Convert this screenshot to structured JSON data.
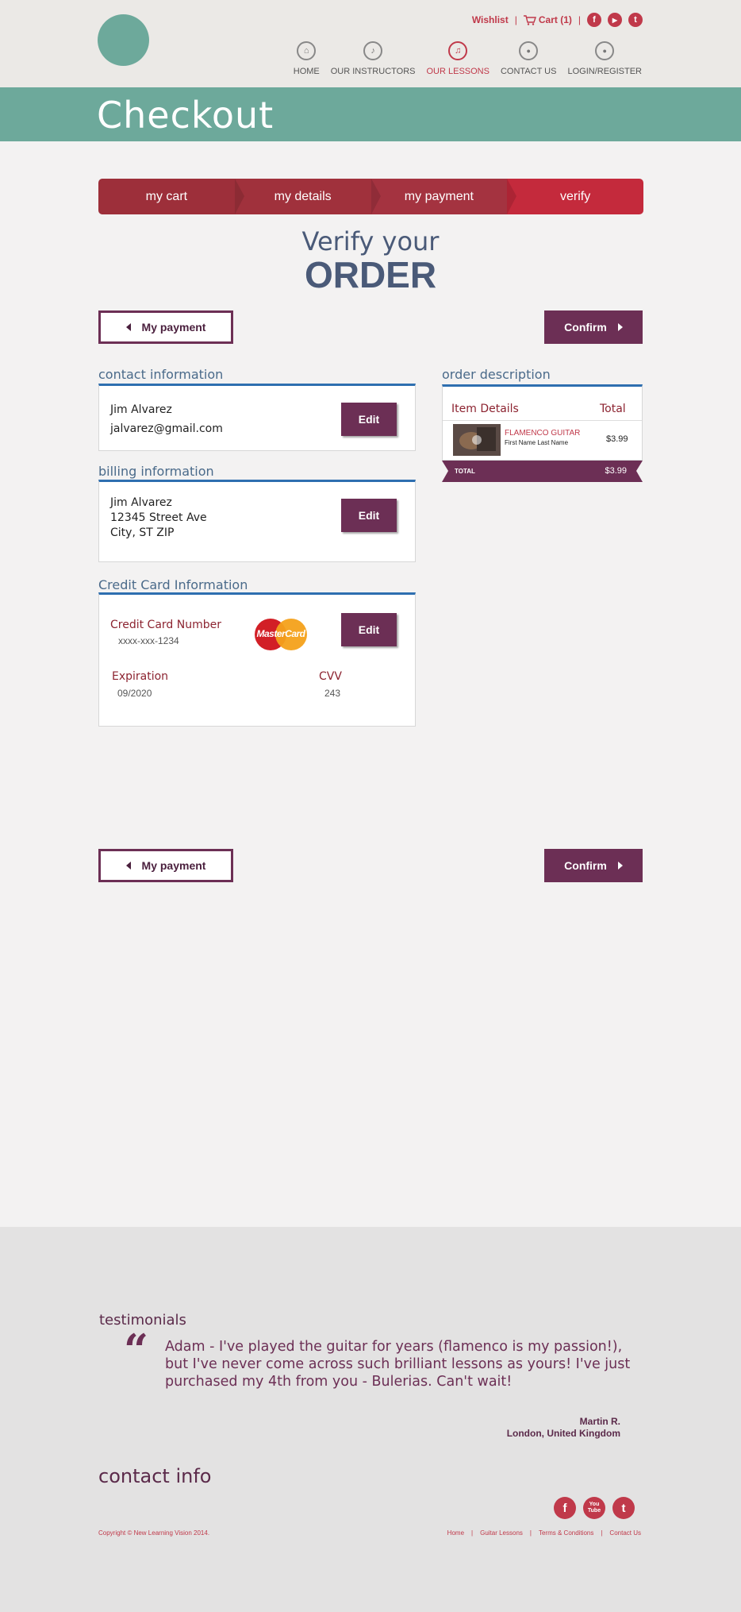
{
  "header": {
    "wishlist": "Wishlist",
    "cart": "Cart (1)",
    "separator": "|",
    "social": [
      "f",
      "▶",
      "t"
    ],
    "nav": [
      {
        "label": "HOME",
        "icon": "home-icon",
        "glyph": "⌂"
      },
      {
        "label": "OUR INSTRUCTORS",
        "icon": "music-note-icon",
        "glyph": "♪"
      },
      {
        "label": "OUR LESSONS",
        "icon": "guitar-icon",
        "glyph": "♫"
      },
      {
        "label": "CONTACT US",
        "icon": "chat-bubble-icon",
        "glyph": "●"
      },
      {
        "label": "LOGIN/REGISTER",
        "icon": "user-icon",
        "glyph": "●"
      }
    ]
  },
  "banner": {
    "title": "Checkout"
  },
  "steps": [
    "my cart",
    "my details",
    "my payment",
    "verify"
  ],
  "verify": {
    "line1": "Verify your",
    "line2": "ORDER"
  },
  "buttons": {
    "back": "My payment",
    "confirm": "Confirm",
    "edit": "Edit"
  },
  "contact": {
    "title": "contact information",
    "name": "Jim Alvarez",
    "email": "jalvarez@gmail.com"
  },
  "billing": {
    "title": "billing information",
    "name": "Jim Alvarez",
    "street": "12345 Street Ave",
    "city": "City, ST ZIP"
  },
  "card": {
    "title": "Credit Card Information",
    "number_label": "Credit Card Number",
    "number": "xxxx-xxx-1234",
    "brand": "MasterCard",
    "expiration_label": "Expiration",
    "expiration": "09/2020",
    "cvv_label": "CVV",
    "cvv": "243"
  },
  "order": {
    "title": "order description",
    "col_item": "Item Details",
    "col_total": "Total",
    "item_name": "FLAMENCO GUITAR",
    "item_sub": "First Name Last Name",
    "item_price": "$3.99",
    "total_label": "TOTAL",
    "total_value": "$3.99"
  },
  "footer": {
    "testimonials_title": "testimonials",
    "quote_mark": "“",
    "testimonial": "Adam - I've played the guitar for years (flamenco is my passion!), but I've never come across such brilliant lessons as yours! I've just purchased my 4th from you - Bulerias. Can't wait!",
    "author": "Martin R.",
    "location": "London, United Kingdom",
    "contact_title": "contact info",
    "social": [
      "f",
      "You Tube",
      "t"
    ],
    "copyright": "Copyright © New Learning Vision 2014.",
    "links": [
      "Home",
      "|",
      "Guitar Lessons",
      "|",
      "Terms & Conditions",
      "|",
      "Contact Us"
    ]
  }
}
